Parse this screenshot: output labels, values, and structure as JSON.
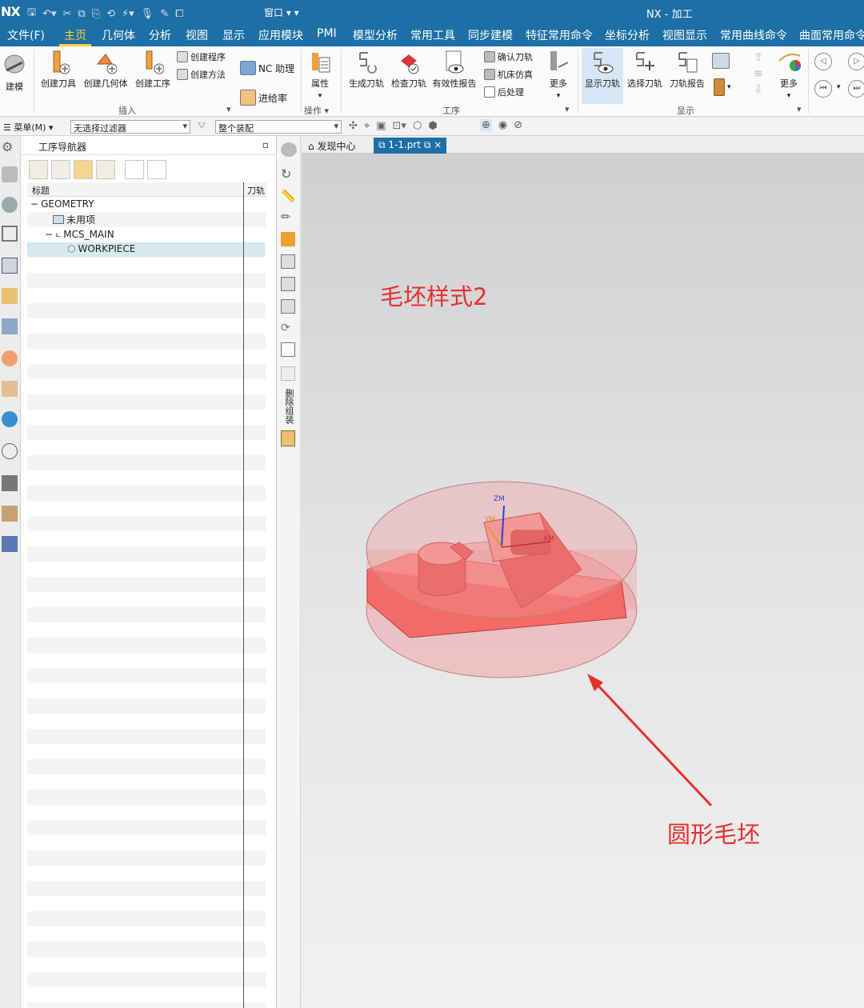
{
  "titlebar": {
    "logo": "NX",
    "window_menu": "窗口",
    "title": "NX - 加工"
  },
  "menu": [
    "文件(F)",
    "主页",
    "几何体",
    "分析",
    "视图",
    "显示",
    "应用模块",
    "PMI",
    "模型分析",
    "常用工具",
    "同步建模",
    "特征常用命令",
    "坐标分析",
    "视图显示",
    "常用曲线命令",
    "曲面常用命令"
  ],
  "ribbon": {
    "modeling": "建模",
    "create_tool": "创建刀具",
    "create_geometry": "创建几何体",
    "create_operation": "创建工序",
    "create_program": "创建程序",
    "create_method": "创建方法",
    "nc_assistant": "NC 助理",
    "feed_rate": "进给率",
    "properties": "属性",
    "generate_toolpath": "生成刀轨",
    "check_toolpath": "检查刀轨",
    "validity_report": "有效性报告",
    "confirm_toolpath": "确认刀轨",
    "machine_sim": "机床仿真",
    "postprocess": "后处理",
    "more": "更多",
    "show_toolpath": "显示刀轨",
    "select_toolpath": "选择刀轨",
    "toolpath_report": "刀轨报告",
    "more2": "更多",
    "group_insert": "插入",
    "group_operate": "操作",
    "group_operation": "工序",
    "group_display": "显示"
  },
  "filterbar": {
    "menu": "菜单(M)",
    "filter": "无选择过滤器",
    "assembly": "整个装配"
  },
  "navigator": {
    "title": "工序导航器",
    "col_name": "标题",
    "col_toolpath": "刀轨",
    "tree": [
      "GEOMETRY",
      "未用项",
      "MCS_MAIN",
      "WORKPIECE"
    ]
  },
  "midrail": {
    "vertical_label": "删除组装"
  },
  "tabs": {
    "discover": "发现中心",
    "file": "1-1.prt"
  },
  "axes": {
    "zm": "ZM",
    "ym": "YM",
    "xm": "XM"
  },
  "annotations": {
    "top": "毛坯样式2",
    "bottom": "圆形毛坯"
  },
  "colors": {
    "titlebar": "#1d6fa5",
    "menu_active": "#ffcf3c",
    "part": "#f36a68",
    "blank": "rgba(240,150,150,0.45)",
    "annotation": "#e53030"
  }
}
